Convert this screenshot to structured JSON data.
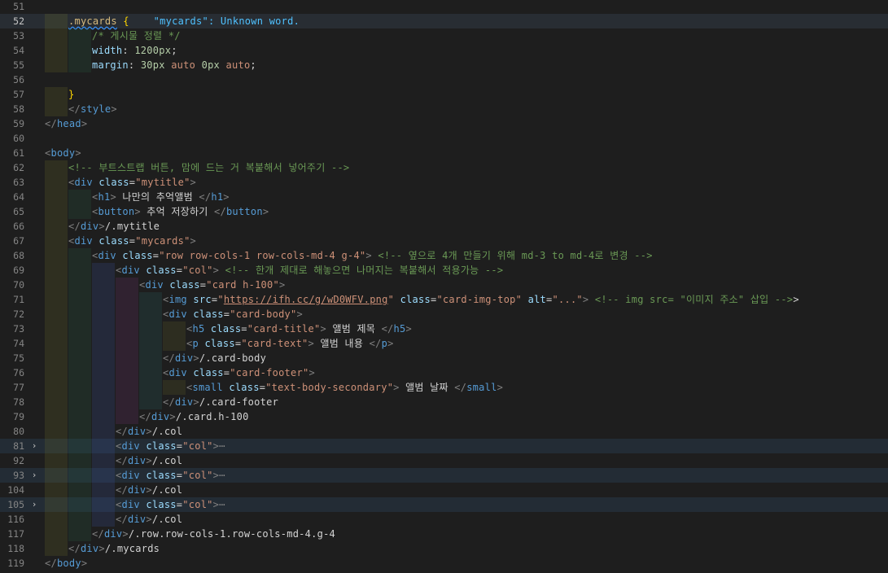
{
  "editor": {
    "lines": [
      {
        "n": "51",
        "segs": []
      },
      {
        "n": "52",
        "segs": [
          [
            "sel",
            ".mycards"
          ],
          [
            "tx",
            " "
          ],
          [
            "br",
            "{"
          ],
          [
            "tx",
            "    "
          ],
          [
            "err",
            "\"mycards\": Unknown word."
          ]
        ]
      },
      {
        "n": "53",
        "segs": [
          [
            "cm",
            "/* 게시물 정렬 */"
          ]
        ]
      },
      {
        "n": "54",
        "segs": [
          [
            "pn",
            "width"
          ],
          [
            "tx",
            ": "
          ],
          [
            "nm",
            "1200px"
          ],
          [
            "tx",
            ";"
          ]
        ]
      },
      {
        "n": "55",
        "segs": [
          [
            "pn",
            "margin"
          ],
          [
            "tx",
            ": "
          ],
          [
            "nm",
            "30px"
          ],
          [
            "tx",
            " "
          ],
          [
            "av",
            "auto"
          ],
          [
            "tx",
            " "
          ],
          [
            "nm",
            "0px"
          ],
          [
            "tx",
            " "
          ],
          [
            "av",
            "auto"
          ],
          [
            "tx",
            ";"
          ]
        ]
      },
      {
        "n": "56",
        "segs": []
      },
      {
        "n": "57",
        "segs": [
          [
            "br",
            "}"
          ]
        ]
      },
      {
        "n": "58",
        "segs": [
          [
            "t",
            "</"
          ],
          [
            "tn",
            "style"
          ],
          [
            "t",
            ">"
          ]
        ]
      },
      {
        "n": "59",
        "segs": [
          [
            "t",
            "</"
          ],
          [
            "tn",
            "head"
          ],
          [
            "t",
            ">"
          ]
        ]
      },
      {
        "n": "60",
        "segs": []
      },
      {
        "n": "61",
        "segs": [
          [
            "t",
            "<"
          ],
          [
            "tn",
            "body"
          ],
          [
            "t",
            ">"
          ]
        ]
      },
      {
        "n": "62",
        "segs": [
          [
            "cm",
            "<!-- 부트스트랩 버튼, 맘에 드는 거 복붙해서 넣어주기 -->"
          ]
        ]
      },
      {
        "n": "63",
        "segs": [
          [
            "t",
            "<"
          ],
          [
            "tn",
            "div"
          ],
          [
            "tx",
            " "
          ],
          [
            "an",
            "class"
          ],
          [
            "tx",
            "="
          ],
          [
            "av",
            "\"mytitle\""
          ],
          [
            "t",
            ">"
          ]
        ]
      },
      {
        "n": "64",
        "segs": [
          [
            "t",
            "<"
          ],
          [
            "tn",
            "h1"
          ],
          [
            "t",
            ">"
          ],
          [
            "tx",
            " 나만의 추억앨범 "
          ],
          [
            "t",
            "</"
          ],
          [
            "tn",
            "h1"
          ],
          [
            "t",
            ">"
          ]
        ]
      },
      {
        "n": "65",
        "segs": [
          [
            "t",
            "<"
          ],
          [
            "tn",
            "button"
          ],
          [
            "t",
            ">"
          ],
          [
            "tx",
            " 추억 저장하기 "
          ],
          [
            "t",
            "</"
          ],
          [
            "tn",
            "button"
          ],
          [
            "t",
            ">"
          ]
        ]
      },
      {
        "n": "66",
        "segs": [
          [
            "t",
            "</"
          ],
          [
            "tn",
            "div"
          ],
          [
            "t",
            ">"
          ],
          [
            "tx",
            "/.mytitle"
          ]
        ]
      },
      {
        "n": "67",
        "segs": [
          [
            "t",
            "<"
          ],
          [
            "tn",
            "div"
          ],
          [
            "tx",
            " "
          ],
          [
            "an",
            "class"
          ],
          [
            "tx",
            "="
          ],
          [
            "av",
            "\"mycards\""
          ],
          [
            "t",
            ">"
          ]
        ]
      },
      {
        "n": "68",
        "segs": [
          [
            "t",
            "<"
          ],
          [
            "tn",
            "div"
          ],
          [
            "tx",
            " "
          ],
          [
            "an",
            "class"
          ],
          [
            "tx",
            "="
          ],
          [
            "av",
            "\"row row-cols-1 row-cols-md-4 g-4\""
          ],
          [
            "t",
            ">"
          ],
          [
            "tx",
            " "
          ],
          [
            "cm",
            "<!-- 옆으로 4개 만들기 위해 md-3 to md-4로 변경 -->"
          ]
        ]
      },
      {
        "n": "69",
        "segs": [
          [
            "t",
            "<"
          ],
          [
            "tn",
            "div"
          ],
          [
            "tx",
            " "
          ],
          [
            "an",
            "class"
          ],
          [
            "tx",
            "="
          ],
          [
            "av",
            "\"col\""
          ],
          [
            "t",
            ">"
          ],
          [
            "tx",
            " "
          ],
          [
            "cm",
            "<!-- 한개 제대로 해놓으면 나머지는 복붙해서 적용가능 -->"
          ]
        ]
      },
      {
        "n": "70",
        "segs": [
          [
            "t",
            "<"
          ],
          [
            "tn",
            "div"
          ],
          [
            "tx",
            " "
          ],
          [
            "an",
            "class"
          ],
          [
            "tx",
            "="
          ],
          [
            "av",
            "\"card h-100\""
          ],
          [
            "t",
            ">"
          ]
        ]
      },
      {
        "n": "71",
        "segs": [
          [
            "t",
            "<"
          ],
          [
            "tn",
            "img"
          ],
          [
            "tx",
            " "
          ],
          [
            "an",
            "src"
          ],
          [
            "tx",
            "="
          ],
          [
            "av",
            "\""
          ],
          [
            "lnk",
            "https://ifh.cc/g/wD0WFV.png"
          ],
          [
            "av",
            "\""
          ],
          [
            "tx",
            " "
          ],
          [
            "an",
            "class"
          ],
          [
            "tx",
            "="
          ],
          [
            "av",
            "\"card-img-top\""
          ],
          [
            "tx",
            " "
          ],
          [
            "an",
            "alt"
          ],
          [
            "tx",
            "="
          ],
          [
            "av",
            "\"...\""
          ],
          [
            "t",
            ">"
          ],
          [
            "tx",
            " "
          ],
          [
            "cm",
            "<!-- img src= \"이미지 주소\" 삽입 -->"
          ],
          [
            "tx",
            ">"
          ]
        ]
      },
      {
        "n": "72",
        "segs": [
          [
            "t",
            "<"
          ],
          [
            "tn",
            "div"
          ],
          [
            "tx",
            " "
          ],
          [
            "an",
            "class"
          ],
          [
            "tx",
            "="
          ],
          [
            "av",
            "\"card-body\""
          ],
          [
            "t",
            ">"
          ]
        ]
      },
      {
        "n": "73",
        "segs": [
          [
            "t",
            "<"
          ],
          [
            "tn",
            "h5"
          ],
          [
            "tx",
            " "
          ],
          [
            "an",
            "class"
          ],
          [
            "tx",
            "="
          ],
          [
            "av",
            "\"card-title\""
          ],
          [
            "t",
            ">"
          ],
          [
            "tx",
            " 앨범 제목 "
          ],
          [
            "t",
            "</"
          ],
          [
            "tn",
            "h5"
          ],
          [
            "t",
            ">"
          ]
        ]
      },
      {
        "n": "74",
        "segs": [
          [
            "t",
            "<"
          ],
          [
            "tn",
            "p"
          ],
          [
            "tx",
            " "
          ],
          [
            "an",
            "class"
          ],
          [
            "tx",
            "="
          ],
          [
            "av",
            "\"card-text\""
          ],
          [
            "t",
            ">"
          ],
          [
            "tx",
            " 앨범 내용 "
          ],
          [
            "t",
            "</"
          ],
          [
            "tn",
            "p"
          ],
          [
            "t",
            ">"
          ]
        ]
      },
      {
        "n": "75",
        "segs": [
          [
            "t",
            "</"
          ],
          [
            "tn",
            "div"
          ],
          [
            "t",
            ">"
          ],
          [
            "tx",
            "/.card-body"
          ]
        ]
      },
      {
        "n": "76",
        "segs": [
          [
            "t",
            "<"
          ],
          [
            "tn",
            "div"
          ],
          [
            "tx",
            " "
          ],
          [
            "an",
            "class"
          ],
          [
            "tx",
            "="
          ],
          [
            "av",
            "\"card-footer\""
          ],
          [
            "t",
            ">"
          ]
        ]
      },
      {
        "n": "77",
        "segs": [
          [
            "t",
            "<"
          ],
          [
            "tn",
            "small"
          ],
          [
            "tx",
            " "
          ],
          [
            "an",
            "class"
          ],
          [
            "tx",
            "="
          ],
          [
            "av",
            "\"text-body-secondary\""
          ],
          [
            "t",
            ">"
          ],
          [
            "tx",
            " 앨범 날짜 "
          ],
          [
            "t",
            "</"
          ],
          [
            "tn",
            "small"
          ],
          [
            "t",
            ">"
          ]
        ]
      },
      {
        "n": "78",
        "segs": [
          [
            "t",
            "</"
          ],
          [
            "tn",
            "div"
          ],
          [
            "t",
            ">"
          ],
          [
            "tx",
            "/.card-footer"
          ]
        ]
      },
      {
        "n": "79",
        "segs": [
          [
            "t",
            "</"
          ],
          [
            "tn",
            "div"
          ],
          [
            "t",
            ">"
          ],
          [
            "tx",
            "/.card.h-100"
          ]
        ]
      },
      {
        "n": "80",
        "segs": [
          [
            "t",
            "</"
          ],
          [
            "tn",
            "div"
          ],
          [
            "t",
            ">"
          ],
          [
            "tx",
            "/.col"
          ]
        ]
      },
      {
        "n": "81",
        "segs": [
          [
            "t",
            "<"
          ],
          [
            "tn",
            "div"
          ],
          [
            "tx",
            " "
          ],
          [
            "an",
            "class"
          ],
          [
            "tx",
            "="
          ],
          [
            "av",
            "\"col\""
          ],
          [
            "t",
            ">"
          ],
          [
            "ell",
            "⋯"
          ]
        ]
      },
      {
        "n": "92",
        "segs": [
          [
            "t",
            "</"
          ],
          [
            "tn",
            "div"
          ],
          [
            "t",
            ">"
          ],
          [
            "tx",
            "/.col"
          ]
        ]
      },
      {
        "n": "93",
        "segs": [
          [
            "t",
            "<"
          ],
          [
            "tn",
            "div"
          ],
          [
            "tx",
            " "
          ],
          [
            "an",
            "class"
          ],
          [
            "tx",
            "="
          ],
          [
            "av",
            "\"col\""
          ],
          [
            "t",
            ">"
          ],
          [
            "ell",
            "⋯"
          ]
        ]
      },
      {
        "n": "104",
        "segs": [
          [
            "t",
            "</"
          ],
          [
            "tn",
            "div"
          ],
          [
            "t",
            ">"
          ],
          [
            "tx",
            "/.col"
          ]
        ]
      },
      {
        "n": "105",
        "segs": [
          [
            "t",
            "<"
          ],
          [
            "tn",
            "div"
          ],
          [
            "tx",
            " "
          ],
          [
            "an",
            "class"
          ],
          [
            "tx",
            "="
          ],
          [
            "av",
            "\"col\""
          ],
          [
            "t",
            ">"
          ],
          [
            "ell",
            "⋯"
          ]
        ]
      },
      {
        "n": "116",
        "segs": [
          [
            "t",
            "</"
          ],
          [
            "tn",
            "div"
          ],
          [
            "t",
            ">"
          ],
          [
            "tx",
            "/.col"
          ]
        ]
      },
      {
        "n": "117",
        "segs": [
          [
            "t",
            "</"
          ],
          [
            "tn",
            "div"
          ],
          [
            "t",
            ">"
          ],
          [
            "tx",
            "/.row.row-cols-1.row-cols-md-4.g-4"
          ]
        ]
      },
      {
        "n": "118",
        "segs": [
          [
            "t",
            "</"
          ],
          [
            "tn",
            "div"
          ],
          [
            "t",
            ">"
          ],
          [
            "tx",
            "/.mycards"
          ]
        ]
      },
      {
        "n": "119",
        "segs": [
          [
            "t",
            "</"
          ],
          [
            "tn",
            "body"
          ],
          [
            "t",
            ">"
          ]
        ]
      }
    ],
    "fold_icon": "chevron-right-icon",
    "colors": {
      "background": "#1e1e1e",
      "tag": "#569cd6",
      "attribute": "#9cdcfe",
      "string": "#ce9178",
      "comment": "#6a9955",
      "selector": "#d7ba7d",
      "number": "#b5cea8"
    }
  }
}
